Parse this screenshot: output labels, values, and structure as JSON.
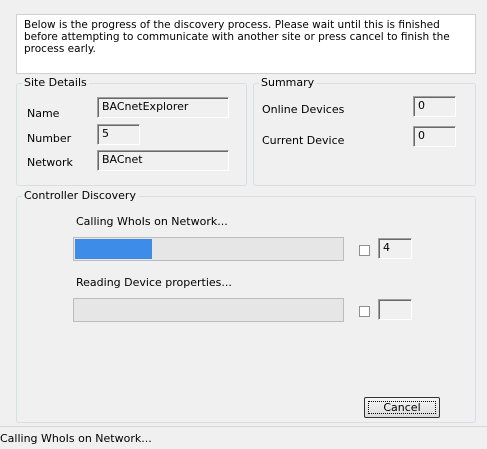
{
  "intro": {
    "message": "Below is the progress of the discovery process. Please wait until this is finished before attempting to communicate with another site or press cancel to finish the process early."
  },
  "site_details": {
    "title": "Site Details",
    "name_label": "Name",
    "name_value": "BACnetExplorer",
    "number_label": "Number",
    "number_value": "5",
    "network_label": "Network",
    "network_value": "BACnet"
  },
  "summary": {
    "title": "Summary",
    "online_devices_label": "Online Devices",
    "online_devices_value": "0",
    "current_device_label": "Current Device",
    "current_device_value": "0"
  },
  "controller_discovery": {
    "title": "Controller Discovery",
    "step1_label": "Calling WhoIs on Network...",
    "step1_progress": 0.29,
    "step1_checked": false,
    "step1_count": "4",
    "step2_label": "Reading Device properties...",
    "step2_progress": 0,
    "step2_checked": false,
    "step2_count": ""
  },
  "buttons": {
    "cancel_label": "Cancel"
  },
  "status_bar": {
    "text": "Calling WhoIs on Network..."
  },
  "colors": {
    "progress_fill": "#3c8ce8",
    "background": "#f0f0f0"
  }
}
